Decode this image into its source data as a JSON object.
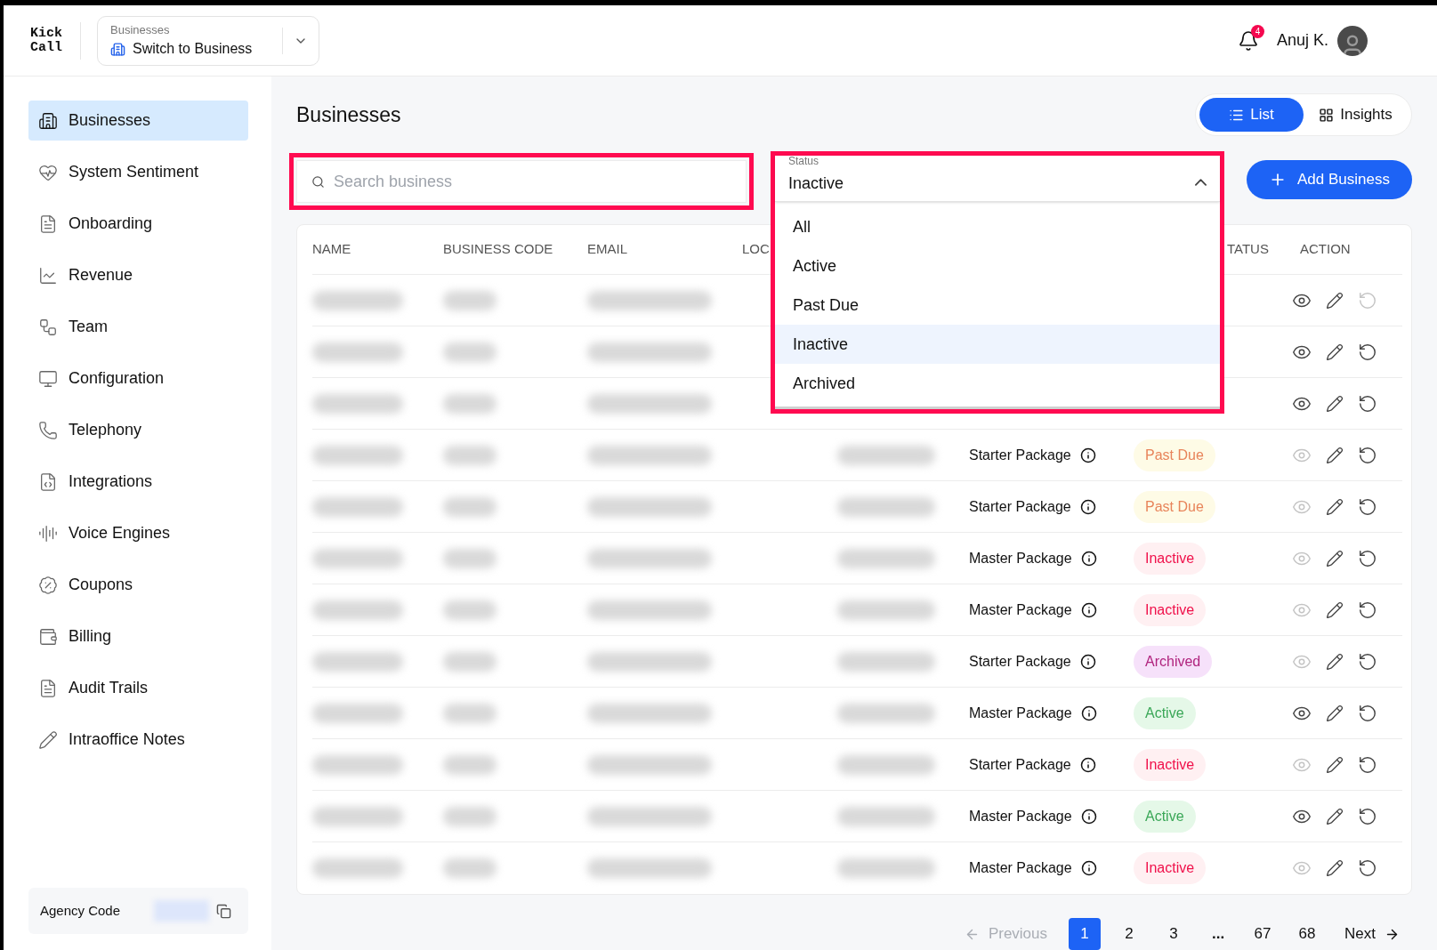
{
  "header": {
    "logo": [
      "Kick",
      "Call"
    ],
    "switcher": {
      "label": "Businesses",
      "value": "Switch to Business"
    },
    "notifications": {
      "count": "4"
    },
    "user": {
      "name": "Anuj K."
    }
  },
  "sidebar": {
    "items": [
      {
        "label": "Businesses",
        "selected": true
      },
      {
        "label": "System Sentiment",
        "selected": false
      },
      {
        "label": "Onboarding",
        "selected": false
      },
      {
        "label": "Revenue",
        "selected": false
      },
      {
        "label": "Team",
        "selected": false
      },
      {
        "label": "Configuration",
        "selected": false
      },
      {
        "label": "Telephony",
        "selected": false
      },
      {
        "label": "Integrations",
        "selected": false
      },
      {
        "label": "Voice Engines",
        "selected": false
      },
      {
        "label": "Coupons",
        "selected": false
      },
      {
        "label": "Billing",
        "selected": false
      },
      {
        "label": "Audit Trails",
        "selected": false
      },
      {
        "label": "Intraoffice Notes",
        "selected": false
      }
    ],
    "agency_code": {
      "label": "Agency Code"
    }
  },
  "page": {
    "title": "Businesses",
    "views": [
      {
        "label": "List",
        "selected": true
      },
      {
        "label": "Insights",
        "selected": false
      }
    ],
    "search": {
      "placeholder": "Search business"
    },
    "status_filter": {
      "label": "Status",
      "value": "Inactive",
      "expanded": true,
      "options": [
        {
          "label": "All",
          "selected": false
        },
        {
          "label": "Active",
          "selected": false
        },
        {
          "label": "Past Due",
          "selected": false
        },
        {
          "label": "Inactive",
          "selected": true
        },
        {
          "label": "Archived",
          "selected": false
        }
      ]
    },
    "add_button": "Add Business"
  },
  "table": {
    "columns": [
      "NAME",
      "BUSINESS CODE",
      "EMAIL",
      "LOC",
      "TATUS",
      "ACTION"
    ],
    "rows": [
      {
        "view_enabled": true,
        "restore_enabled": false
      },
      {
        "view_enabled": true,
        "restore_enabled": true
      },
      {
        "view_enabled": true,
        "restore_enabled": true
      },
      {
        "package": "Starter Package",
        "status": {
          "label": "Past Due",
          "kind": "past_due"
        },
        "view_enabled": false,
        "restore_enabled": true
      },
      {
        "package": "Starter Package",
        "status": {
          "label": "Past Due",
          "kind": "past_due"
        },
        "view_enabled": false,
        "restore_enabled": true
      },
      {
        "package": "Master Package",
        "status": {
          "label": "Inactive",
          "kind": "inactive"
        },
        "view_enabled": false,
        "restore_enabled": true
      },
      {
        "package": "Master Package",
        "status": {
          "label": "Inactive",
          "kind": "inactive"
        },
        "view_enabled": false,
        "restore_enabled": true
      },
      {
        "package": "Starter Package",
        "status": {
          "label": "Archived",
          "kind": "archived"
        },
        "view_enabled": false,
        "restore_enabled": true
      },
      {
        "package": "Master Package",
        "status": {
          "label": "Active",
          "kind": "active"
        },
        "view_enabled": true,
        "restore_enabled": true
      },
      {
        "package": "Starter Package",
        "status": {
          "label": "Inactive",
          "kind": "inactive"
        },
        "view_enabled": false,
        "restore_enabled": true
      },
      {
        "package": "Master Package",
        "status": {
          "label": "Active",
          "kind": "active"
        },
        "view_enabled": true,
        "restore_enabled": true
      },
      {
        "package": "Master Package",
        "status": {
          "label": "Inactive",
          "kind": "inactive"
        },
        "view_enabled": false,
        "restore_enabled": true
      }
    ]
  },
  "pagination": {
    "previous": {
      "label": "Previous",
      "disabled": true
    },
    "pages": [
      {
        "label": "1",
        "selected": true
      },
      {
        "label": "2",
        "selected": false
      },
      {
        "label": "3",
        "selected": false
      },
      {
        "label": "...",
        "selected": false
      },
      {
        "label": "67",
        "selected": false
      },
      {
        "label": "68",
        "selected": false
      }
    ],
    "next": {
      "label": "Next",
      "disabled": false
    }
  }
}
